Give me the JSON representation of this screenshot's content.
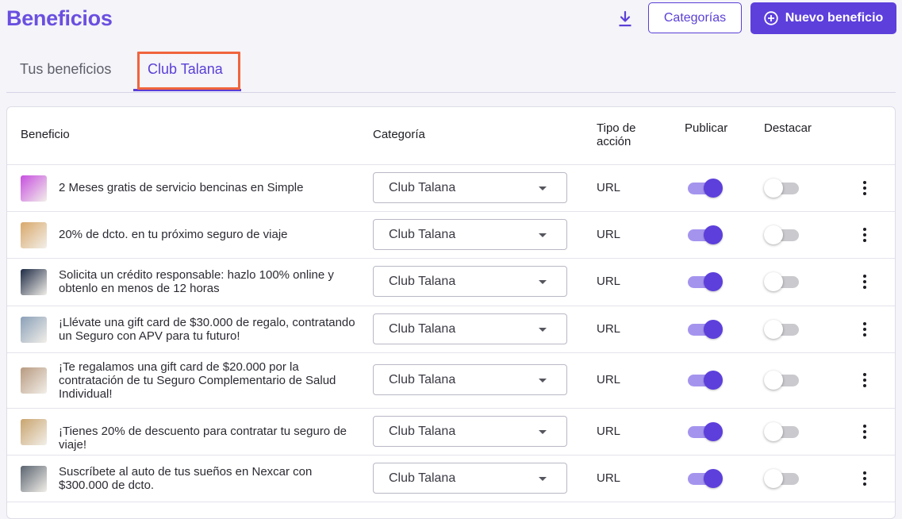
{
  "header": {
    "title": "Beneficios",
    "download_icon": "download-icon",
    "categories_button": "Categorías",
    "new_button": "Nuevo beneficio",
    "new_button_icon": "plus-circle-icon"
  },
  "tabs": [
    {
      "label": "Tus beneficios",
      "active": false
    },
    {
      "label": "Club Talana",
      "active": true
    }
  ],
  "table": {
    "columns": {
      "benefit": "Beneficio",
      "category": "Categoría",
      "action_type": "Tipo de acción",
      "publish": "Publicar",
      "highlight": "Destacar"
    },
    "rows": [
      {
        "title": "2 Meses gratis de servicio bencinas en Simple",
        "category": "Club Talana",
        "action_type": "URL",
        "published": true,
        "highlighted": false,
        "thumb_color": "#c74fe0"
      },
      {
        "title": "20% de dcto. en tu próximo seguro de viaje",
        "category": "Club Talana",
        "action_type": "URL",
        "published": true,
        "highlighted": false,
        "thumb_color": "#d9a86a"
      },
      {
        "title": "Solicita un crédito responsable: hazlo 100% online y obtenlo en menos de 12 horas",
        "category": "Club Talana",
        "action_type": "URL",
        "published": true,
        "highlighted": false,
        "thumb_color": "#1e2b45"
      },
      {
        "title": "¡Llévate una gift card de $30.000 de regalo, contratando un Seguro con APV para tu futuro!",
        "category": "Club Talana",
        "action_type": "URL",
        "published": true,
        "highlighted": false,
        "thumb_color": "#8aa0b8"
      },
      {
        "title": "¡Te regalamos una gift card de $20.000 por la contratación de tu Seguro Complementario de Salud Individual!",
        "category": "Club Talana",
        "action_type": "URL",
        "published": true,
        "highlighted": false,
        "thumb_color": "#b89a80"
      },
      {
        "title": "¡Tienes 20% de descuento para contratar tu seguro de viaje!",
        "category": "Club Talana",
        "action_type": "URL",
        "published": true,
        "highlighted": false,
        "thumb_color": "#c9a46e"
      },
      {
        "title": "Suscríbete al auto de tus sueños en Nexcar con $300.000 de dcto.",
        "category": "Club Talana",
        "action_type": "URL",
        "published": true,
        "highlighted": false,
        "thumb_color": "#5a6470"
      }
    ]
  },
  "colors": {
    "accent": "#5d3fdc",
    "title": "#6a4fe0",
    "tab_highlight_border": "#f0643c"
  }
}
